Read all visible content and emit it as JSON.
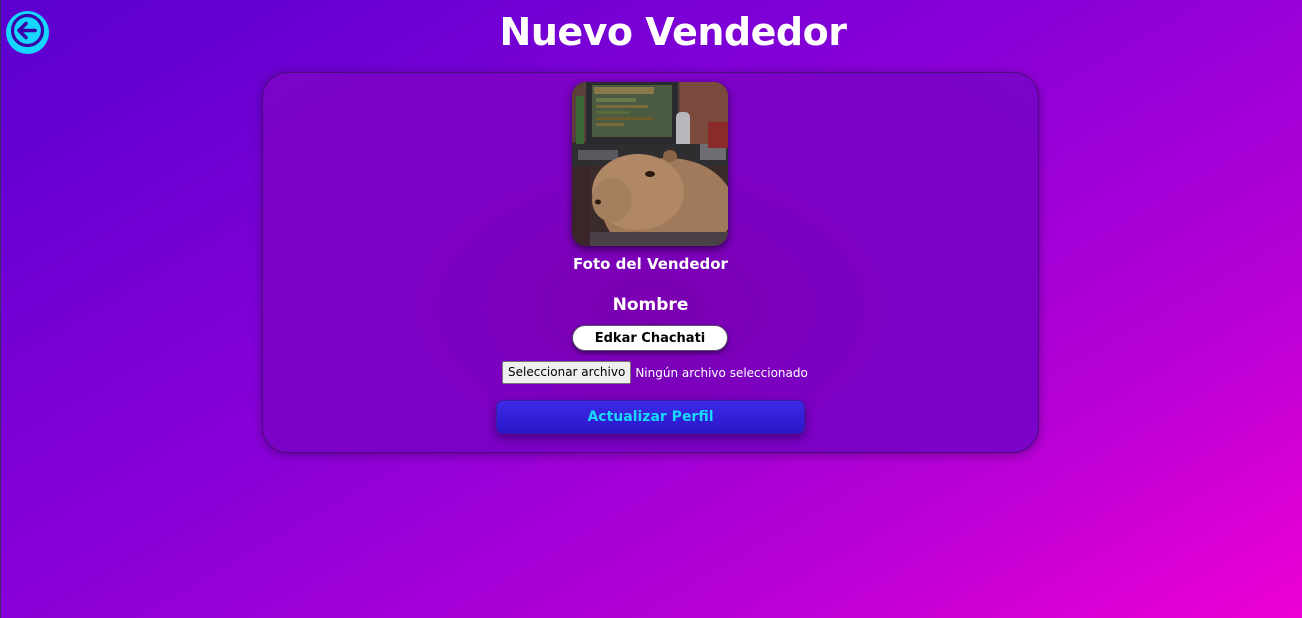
{
  "header": {
    "title": "Nuevo Vendedor",
    "back_icon": "arrow-left-icon"
  },
  "form": {
    "photo_caption": "Foto del Vendedor",
    "photo_image": "seller-photo-capybara",
    "name_label": "Nombre",
    "name_value": "Edkar Chachati",
    "file_button_label": "Seleccionar archivo",
    "file_status": "Ningún archivo seleccionado",
    "submit_label": "Actualizar Perfil"
  },
  "colors": {
    "accent": "#16d6ff",
    "submit_bg": "#2f1cd6",
    "background_start": "#5a00cf",
    "background_end": "#ee00d4"
  }
}
